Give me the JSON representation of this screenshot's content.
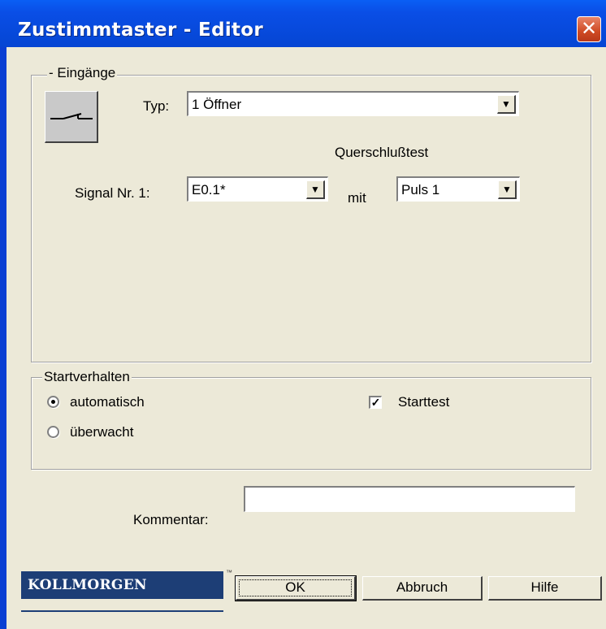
{
  "window": {
    "title": "Zustimmtaster - Editor",
    "close_glyph": "✕"
  },
  "inputs_group": {
    "legend": "- Eingänge",
    "icon": "normally-closed-switch-icon",
    "typ_label": "Typ:",
    "typ_value": "1 Öffner",
    "cross_test_heading": "Querschlußtest",
    "signal_label": "Signal Nr. 1:",
    "signal_value": "E0.1*",
    "mit_label": "mit",
    "pulse_value": "Puls 1"
  },
  "start_group": {
    "legend": "Startverhalten",
    "radio_auto_label": "automatisch",
    "radio_auto_selected": true,
    "radio_monitored_label": "überwacht",
    "radio_monitored_selected": false,
    "starttest_label": "Starttest",
    "starttest_checked": true
  },
  "comment": {
    "label": "Kommentar:",
    "value": ""
  },
  "footer": {
    "logo_text": "KOLLMORGEN",
    "logo_tm": "™",
    "ok_label": "OK",
    "cancel_label": "Abbruch",
    "help_label": "Hilfe"
  },
  "colors": {
    "title_bar": "#0a4ee6",
    "dialog_bg": "#ece9d8",
    "logo_bg": "#1d3e76",
    "close_btn": "#cf4a23"
  }
}
